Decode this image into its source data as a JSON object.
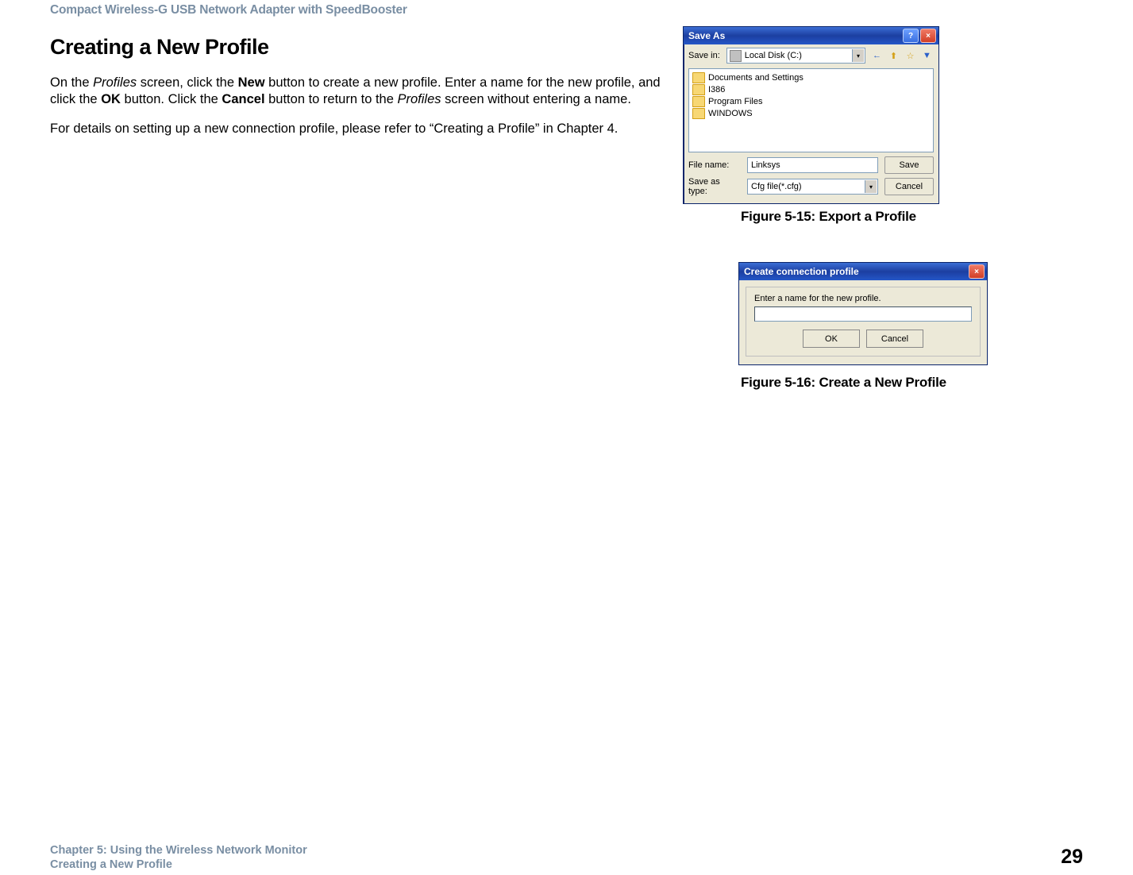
{
  "header": {
    "top": "Compact Wireless-G USB Network Adapter with SpeedBooster"
  },
  "section": {
    "title": "Creating a New Profile",
    "p1_pre": "On the ",
    "p1_profiles": "Profiles",
    "p1_mid1": " screen, click the ",
    "p1_new": "New",
    "p1_mid2": " button to create a new profile. Enter a name for the new profile, and click the ",
    "p1_ok": "OK",
    "p1_mid3": " button. Click the ",
    "p1_cancel": "Cancel",
    "p1_mid4": " button to return to the ",
    "p1_profiles2": "Profiles",
    "p1_end": " screen without entering a name.",
    "p2": "For details on setting up a new connection profile, please refer to “Creating a Profile” in Chapter 4."
  },
  "figures": {
    "cap1": "Figure 5-15: Export a Profile",
    "cap2": "Figure 5-16: Create a New Profile"
  },
  "footer": {
    "line1": "Chapter 5: Using the Wireless Network Monitor",
    "line2": "Creating a New Profile",
    "page": "29"
  },
  "saveas": {
    "title": "Save As",
    "help": "?",
    "close": "×",
    "savein_label": "Save in:",
    "savein_value": "Local Disk (C:)",
    "nav": {
      "back": "←",
      "up": "⬆",
      "new": "☆",
      "view": "▼"
    },
    "files": [
      "Documents and Settings",
      "I386",
      "Program Files",
      "WINDOWS"
    ],
    "filename_label": "File name:",
    "filename_value": "Linksys",
    "savetype_label": "Save as type:",
    "savetype_value": "Cfg file(*.cfg)",
    "save_btn": "Save",
    "cancel_btn": "Cancel"
  },
  "createdlg": {
    "title": "Create connection profile",
    "close": "×",
    "prompt": "Enter a name for the new profile.",
    "ok": "OK",
    "cancel": "Cancel"
  }
}
